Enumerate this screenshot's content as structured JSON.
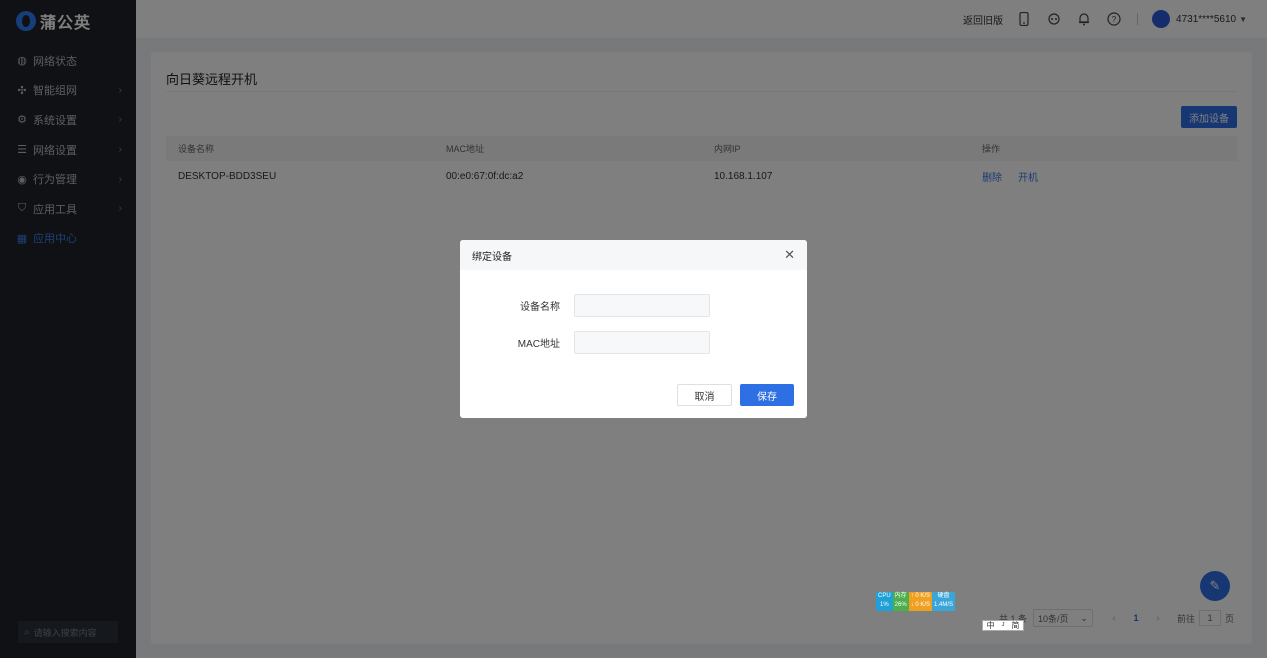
{
  "sidebar": {
    "logo": "蒲公英",
    "items": [
      {
        "label": "网络状态",
        "icon": "globe-icon",
        "has_arrow": false
      },
      {
        "label": "智能组网",
        "icon": "network-icon",
        "has_arrow": true
      },
      {
        "label": "系统设置",
        "icon": "gear-icon",
        "has_arrow": true
      },
      {
        "label": "网络设置",
        "icon": "sliders-icon",
        "has_arrow": true
      },
      {
        "label": "行为管理",
        "icon": "eye-icon",
        "has_arrow": true
      },
      {
        "label": "应用工具",
        "icon": "shield-icon",
        "has_arrow": true
      },
      {
        "label": "应用中心",
        "icon": "apps-icon",
        "has_arrow": false,
        "active": true
      }
    ],
    "search_placeholder": "请输入搜索内容"
  },
  "header": {
    "return_old": "返回旧版",
    "user": "4731****5610"
  },
  "panel": {
    "title": "向日葵远程开机",
    "add_button": "添加设备",
    "columns": [
      "设备名称",
      "MAC地址",
      "内网IP",
      "操作"
    ],
    "rows": [
      {
        "name": "DESKTOP-BDD3SEU",
        "mac": "00:e0:67:0f:dc:a2",
        "ip": "10.168.1.107",
        "actions": [
          "删除",
          "开机"
        ]
      }
    ]
  },
  "pagination": {
    "total": "共 1 条",
    "page_size": "10条/页",
    "current": "1",
    "goto_label": "前往",
    "goto_value": "1",
    "page_unit": "页"
  },
  "modal": {
    "title": "绑定设备",
    "fields": [
      {
        "label": "设备名称",
        "value": ""
      },
      {
        "label": "MAC地址",
        "value": ""
      }
    ],
    "cancel": "取消",
    "save": "保存"
  },
  "sysmon": {
    "cpu_label": "CPU",
    "cpu_value": "1%",
    "mem_label": "内存",
    "mem_value": "26%",
    "up": "0 K/S",
    "down": "0 K/S",
    "disk_label": "硬盘",
    "disk_value": "1.4M/S"
  },
  "ime": [
    "中",
    "ᴶ",
    "简"
  ],
  "colors": {
    "accent": "#2f6fe4",
    "sidebar": "#1f2329"
  }
}
